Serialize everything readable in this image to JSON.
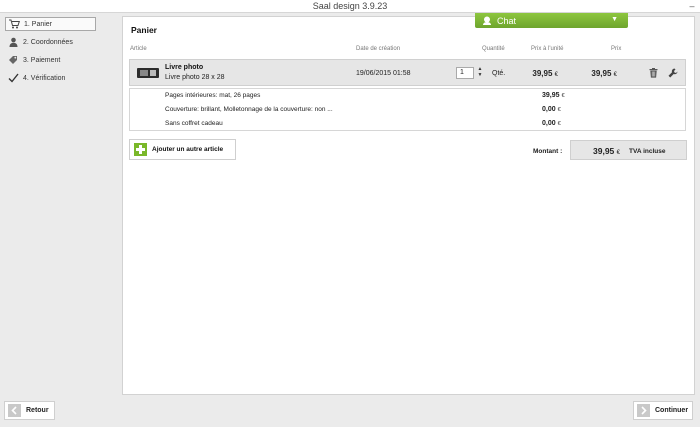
{
  "window": {
    "title": "Saal design 3.9.23",
    "minimize_glyph": "–"
  },
  "sidebar": {
    "steps": [
      {
        "label": "1. Panier",
        "icon": "cart-icon",
        "active": true
      },
      {
        "label": "2. Coordonnées",
        "icon": "person-icon",
        "active": false
      },
      {
        "label": "3. Paiement",
        "icon": "tag-icon",
        "active": false
      },
      {
        "label": "4. Vérification",
        "icon": "checkmark-icon",
        "active": false
      }
    ]
  },
  "chat": {
    "label": "Chat",
    "caret": "▼"
  },
  "cart": {
    "title": "Panier",
    "headers": {
      "article": "Article",
      "date": "Date de création",
      "quantity": "Quantité",
      "unit_price": "Prix à l'unité",
      "price": "Prix"
    },
    "item": {
      "name": "Livre photo",
      "subtitle": "Livre photo 28 x 28",
      "date": "19/06/2015 01:58",
      "quantity": "1",
      "qty_unit": "Qté.",
      "unit_price": "39,95",
      "price": "39,95",
      "currency": "€"
    },
    "details": [
      {
        "label": "Pages intérieures: mat, 26 pages",
        "price": "39,95"
      },
      {
        "label": "Couverture: brillant, Molletonnage de la couverture: non ...",
        "price": "0,00"
      },
      {
        "label": "Sans coffret cadeau",
        "price": "0,00"
      }
    ],
    "add_button": "Ajouter un autre article",
    "total_label": "Montant :",
    "total_value": "39,95",
    "tva": "TVA incluse"
  },
  "footer": {
    "back": "Retour",
    "next": "Continuer"
  },
  "colors": {
    "chat": "#7ab829",
    "accent": "#7ab829"
  }
}
